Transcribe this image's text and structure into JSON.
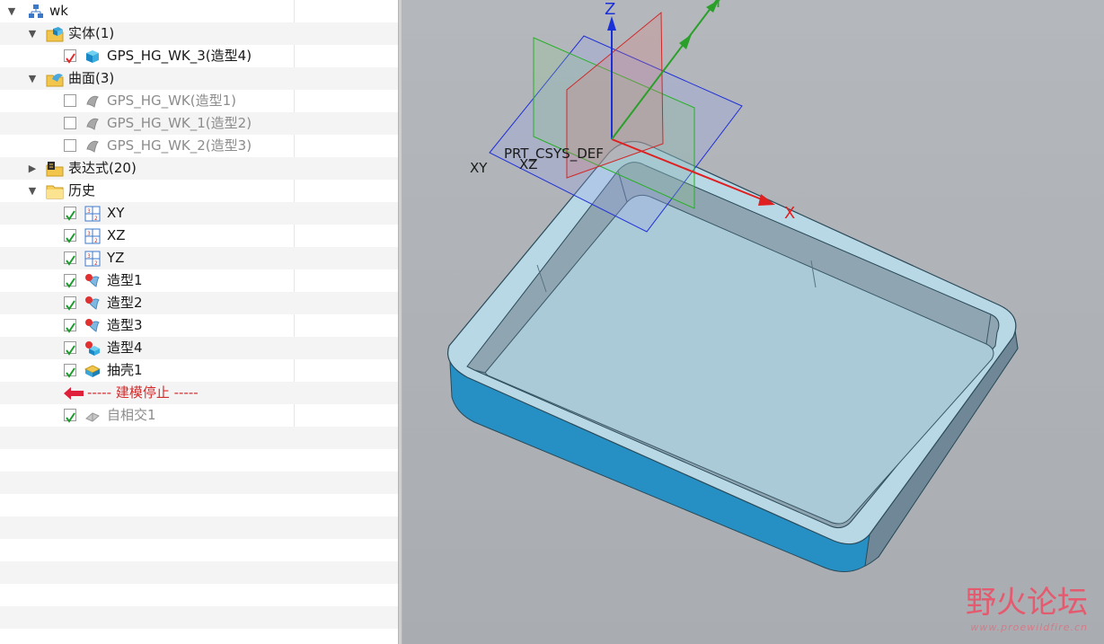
{
  "tree": {
    "root": {
      "label": "wk",
      "icon": "model-tree-icon"
    },
    "solids": {
      "label": "实体(1)",
      "icon": "solid-folder-icon",
      "items": [
        {
          "label": "GPS_HG_WK_3(造型4)",
          "checked": true,
          "icon": "solid-body-icon"
        }
      ]
    },
    "surfaces": {
      "label": "曲面(3)",
      "icon": "surface-folder-icon",
      "items": [
        {
          "label": "GPS_HG_WK(造型1)",
          "checked": false,
          "icon": "surface-icon"
        },
        {
          "label": "GPS_HG_WK_1(造型2)",
          "checked": false,
          "icon": "surface-icon"
        },
        {
          "label": "GPS_HG_WK_2(造型3)",
          "checked": false,
          "icon": "surface-icon"
        }
      ]
    },
    "expressions": {
      "label": "表达式(20)",
      "icon": "expression-folder-icon"
    },
    "history": {
      "label": "历史",
      "icon": "history-folder-icon",
      "items": [
        {
          "label": "XY",
          "checked": true,
          "icon": "datum-plane-icon"
        },
        {
          "label": "XZ",
          "checked": true,
          "icon": "datum-plane-icon"
        },
        {
          "label": "YZ",
          "checked": true,
          "icon": "datum-plane-icon"
        },
        {
          "label": "造型1",
          "checked": true,
          "icon": "shape-feature-icon"
        },
        {
          "label": "造型2",
          "checked": true,
          "icon": "shape-feature-icon"
        },
        {
          "label": "造型3",
          "checked": true,
          "icon": "shape-feature-icon"
        },
        {
          "label": "造型4",
          "checked": true,
          "icon": "shape-solid-feature-icon"
        },
        {
          "label": "抽壳1",
          "checked": true,
          "icon": "shell-icon"
        }
      ],
      "stop_marker": {
        "label": "----- 建模停止 -----",
        "icon": "stop-arrow-icon"
      },
      "after_stop": [
        {
          "label": "自相交1",
          "checked": true,
          "icon": "intersect-icon"
        }
      ]
    }
  },
  "viewport": {
    "csys_label": "PRT_CSYS_DEF",
    "plane_labels": {
      "xy": "XY",
      "xz": "XZ"
    },
    "axis_labels": {
      "x": "X",
      "y": "Y",
      "z": "Z"
    },
    "watermark": {
      "text": "野火论坛",
      "url": "www.proewildfire.cn"
    },
    "colors": {
      "x_axis": "#e02020",
      "y_axis": "#2aa02a",
      "z_axis": "#1a30d8",
      "part": "#a9cad6",
      "part_side": "#1e8fc0"
    }
  }
}
